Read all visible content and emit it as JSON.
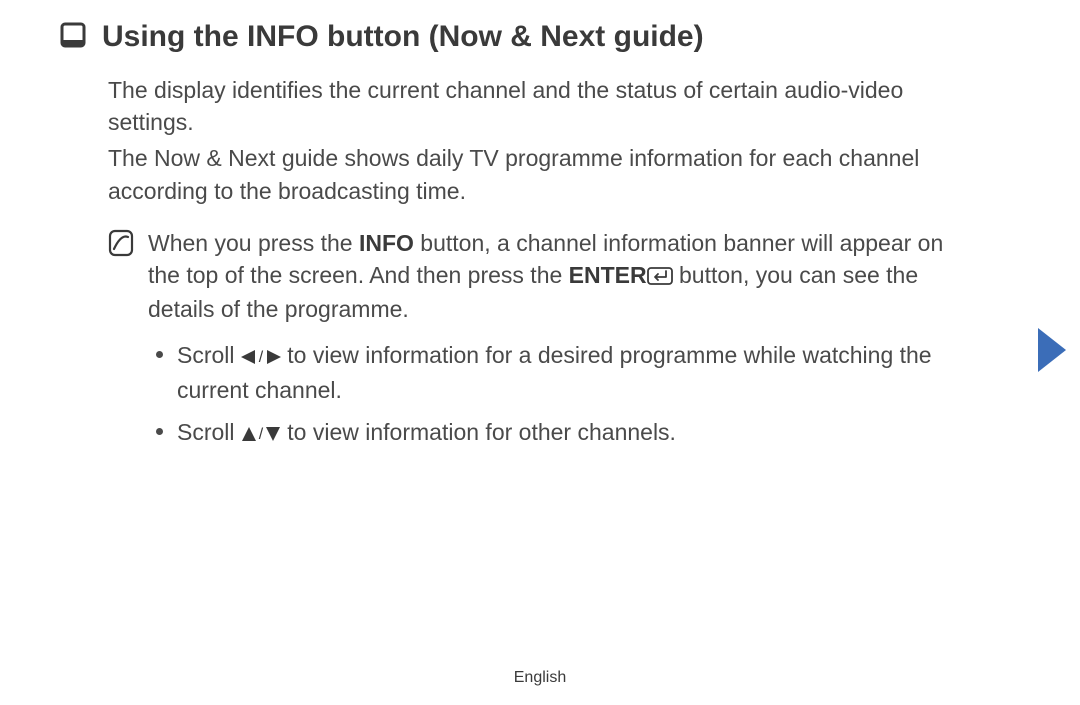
{
  "heading": "Using the INFO button (Now & Next guide)",
  "para1": "The display identifies the current channel and the status of certain audio-video settings.",
  "para2": "The Now & Next guide shows daily TV programme information for each channel according to the broadcasting time.",
  "note": {
    "segments": {
      "pre": "When you press the ",
      "info": "INFO",
      "mid": " button, a channel information banner will appear on the top of the screen. And then press the ",
      "enter": "ENTER",
      "post": " button, you can see the details of the programme."
    }
  },
  "bullets": {
    "b1": {
      "pre": "Scroll ",
      "post": " to view information for a desired programme while watching the current channel."
    },
    "b2": {
      "pre": "Scroll ",
      "post": " to view information for other channels."
    }
  },
  "footer": "English"
}
